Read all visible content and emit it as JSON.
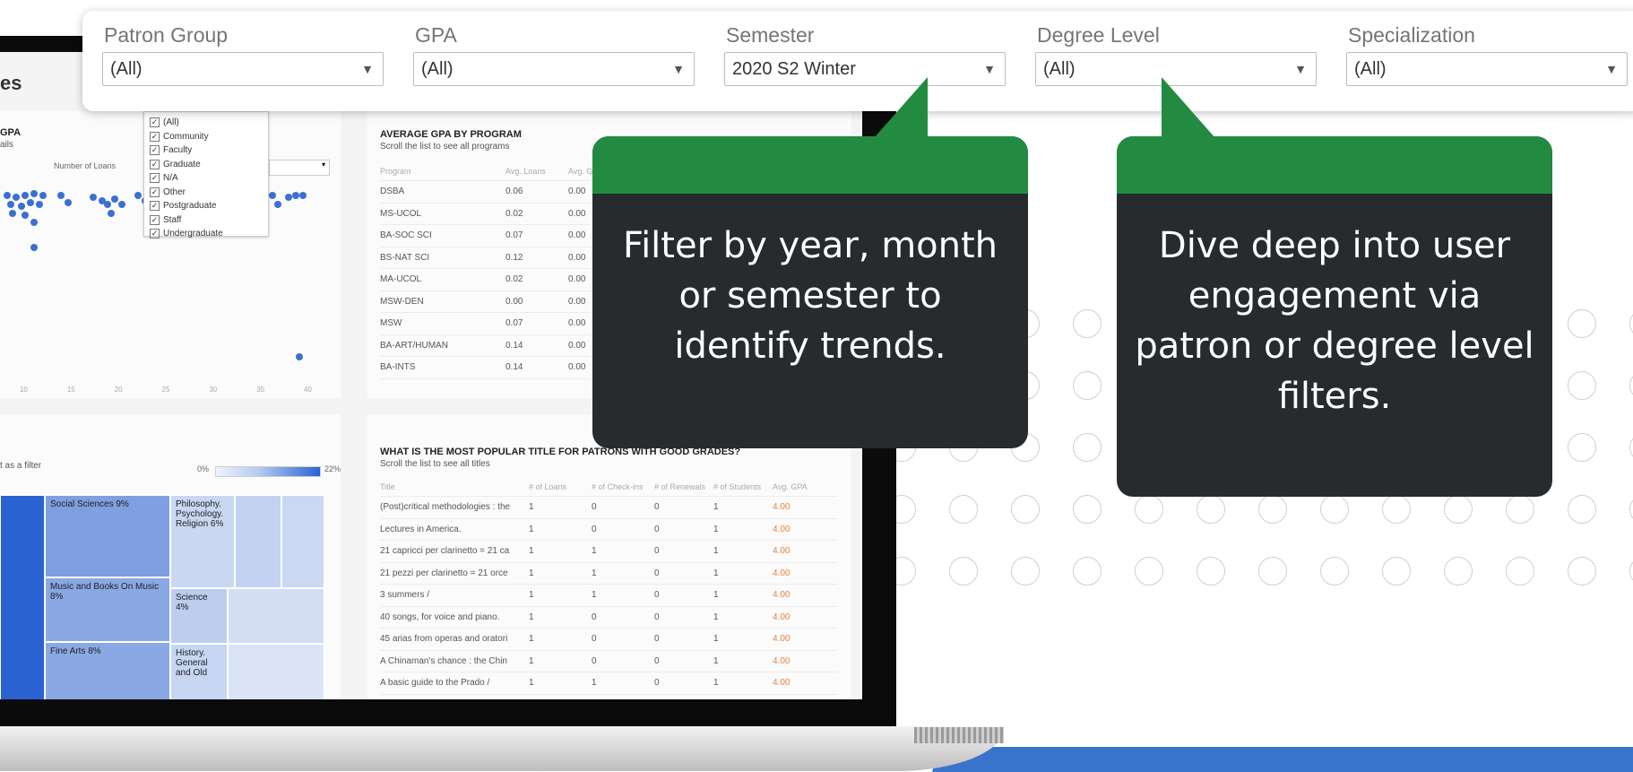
{
  "filters": [
    {
      "label": "Patron Group",
      "value": "(All)"
    },
    {
      "label": "GPA",
      "value": "(All)"
    },
    {
      "label": "Semester",
      "value": "2020 S2 Winter"
    },
    {
      "label": "Degree Level",
      "value": "(All)"
    },
    {
      "label": "Specialization",
      "value": "(All)"
    }
  ],
  "callouts": {
    "left": "Filter by year, month or semester to identify trends.",
    "right": "Dive deep into user engagement via patron or degree level filters."
  },
  "colors": {
    "callout_accent": "#238b41",
    "callout_body": "#272b2d",
    "brand_blue": "#3a73cc"
  },
  "dashboard": {
    "title_fragment": "es",
    "gpa_panel": {
      "title": "GPA",
      "subtitle": "ails",
      "x_label": "Number of Loans",
      "ticks": [
        "10",
        "15",
        "20",
        "25",
        "30",
        "35",
        "40"
      ]
    },
    "patron_list": [
      "(All)",
      "Community",
      "Faculty",
      "Graduate",
      "N/A",
      "Other",
      "Postgraduate",
      "Staff",
      "Undergraduate"
    ],
    "avg_gpa": {
      "title": "AVERAGE GPA BY PROGRAM",
      "subtitle": "Scroll the list to see all programs",
      "headers": [
        "Program",
        "Avg. Loans",
        "Avg. G"
      ],
      "rows": [
        [
          "DSBA",
          "0.06",
          "0.00"
        ],
        [
          "MS-UCOL",
          "0.02",
          "0.00"
        ],
        [
          "BA-SOC SCI",
          "0.07",
          "0.00"
        ],
        [
          "BS-NAT SCI",
          "0.12",
          "0.00"
        ],
        [
          "MA-UCOL",
          "0.02",
          "0.00"
        ],
        [
          "MSW-DEN",
          "0.00",
          "0.00"
        ],
        [
          "MSW",
          "0.07",
          "0.00"
        ],
        [
          "BA-ART/HUMAN",
          "0.14",
          "0.00"
        ],
        [
          "BA-INTS",
          "0.14",
          "0.00"
        ]
      ]
    },
    "treemap": {
      "filter_note": "t as a filter",
      "legend_min": "0%",
      "legend_max": "22%",
      "cells": [
        "Social Sciences 9%",
        "Philosophy. Psychology. Religion 6%",
        "Music and Books On Music 8%",
        "Science 4%",
        "Fine Arts 8%",
        "History. General and Old"
      ]
    },
    "popular_titles": {
      "title": "WHAT IS THE MOST POPULAR TITLE FOR PATRONS WITH GOOD GRADES?",
      "subtitle": "Scroll the list to see all titles",
      "headers": [
        "Title",
        "# of Loans",
        "# of Check-ins",
        "# of Renewals",
        "# of Students",
        "Avg. GPA"
      ],
      "rows": [
        [
          "(Post)critical methodologies : the",
          "1",
          "0",
          "0",
          "1",
          "4.00"
        ],
        [
          "Lectures in America.",
          "1",
          "0",
          "0",
          "1",
          "4.00"
        ],
        [
          "21 capricci per clarinetto = 21 ca",
          "1",
          "1",
          "0",
          "1",
          "4.00"
        ],
        [
          "21 pezzi per clarinetto = 21 orce",
          "1",
          "1",
          "0",
          "1",
          "4.00"
        ],
        [
          "3 summers /",
          "1",
          "1",
          "0",
          "1",
          "4.00"
        ],
        [
          "40 songs, for voice and piano.",
          "1",
          "0",
          "0",
          "1",
          "4.00"
        ],
        [
          "45 arias from operas and oratori",
          "1",
          "0",
          "0",
          "1",
          "4.00"
        ],
        [
          "A Chinaman's chance : the Chin",
          "1",
          "0",
          "0",
          "1",
          "4.00"
        ],
        [
          "A basic guide to the Prado /",
          "1",
          "1",
          "0",
          "1",
          "4.00"
        ]
      ]
    }
  }
}
